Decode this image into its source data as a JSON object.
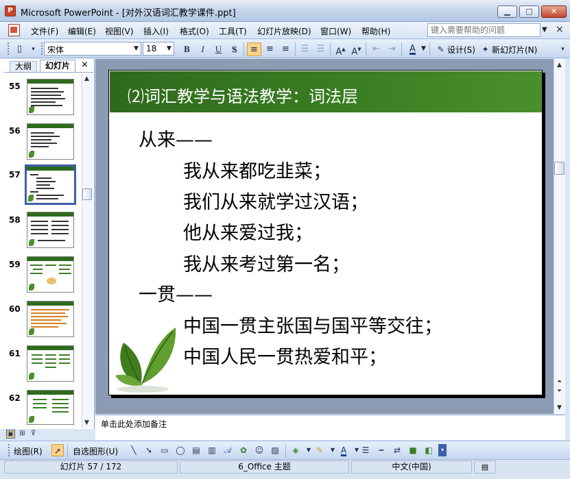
{
  "window": {
    "title": "Microsoft PowerPoint - [对外汉语词汇教学课件.ppt]",
    "min_symbol": "▁",
    "max_symbol": "□",
    "close_symbol": "✕"
  },
  "menu": {
    "items": [
      "文件(F)",
      "编辑(E)",
      "视图(V)",
      "插入(I)",
      "格式(O)",
      "工具(T)",
      "幻灯片放映(D)",
      "窗口(W)",
      "帮助(H)"
    ],
    "help_placeholder": "键入需要帮助的问题",
    "doc_close_symbol": "×"
  },
  "toolbar": {
    "font_name": "宋体",
    "font_size": "18",
    "bold": "B",
    "italic": "I",
    "underline": "U",
    "shadow": "S",
    "design_label": "设计(S)",
    "new_slide_label": "新幻灯片(N)"
  },
  "left_pane": {
    "tab_outline": "大纲",
    "tab_slides": "幻灯片",
    "close_symbol": "×",
    "slides": [
      {
        "num": "55",
        "selected": false
      },
      {
        "num": "56",
        "selected": false
      },
      {
        "num": "57",
        "selected": true
      },
      {
        "num": "58",
        "selected": false
      },
      {
        "num": "59",
        "selected": false
      },
      {
        "num": "60",
        "selected": false
      },
      {
        "num": "61",
        "selected": false
      },
      {
        "num": "62",
        "selected": false
      }
    ]
  },
  "slide": {
    "title": "⑵词汇教学与语法教学：词法层",
    "lines": [
      {
        "text": "从来——",
        "indent": false
      },
      {
        "text": "我从来都吃韭菜；",
        "indent": true
      },
      {
        "text": "我们从来就学过汉语；",
        "indent": true
      },
      {
        "text": "他从来爱过我；",
        "indent": true
      },
      {
        "text": "我从来考过第一名；",
        "indent": true
      },
      {
        "text": "一贯——",
        "indent": false
      },
      {
        "text": "中国一贯主张国与国平等交往；",
        "indent": true
      },
      {
        "text": "中国人民一贯热爱和平；",
        "indent": true
      }
    ],
    "colors": {
      "header": "#2f6a1c",
      "leaf": "#4f8e2c"
    }
  },
  "notes": {
    "placeholder": "单击此处添加备注"
  },
  "drawbar": {
    "draw_label": "绘图(R)",
    "autoshape_label": "自选图形(U)"
  },
  "status": {
    "slide_info": "幻灯片 57 / 172",
    "theme": "6_Office 主题",
    "language": "中文(中国)"
  }
}
